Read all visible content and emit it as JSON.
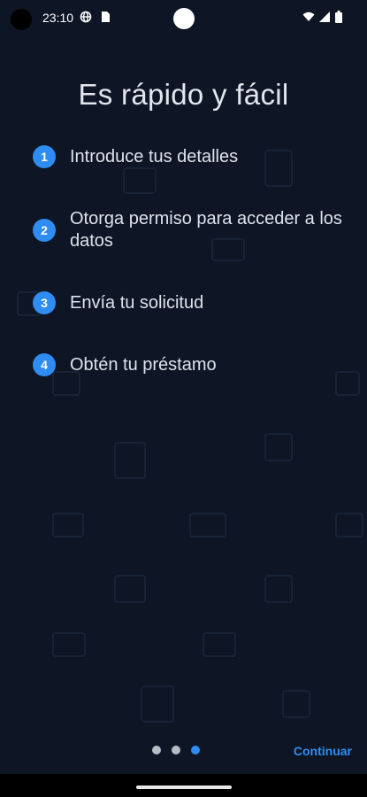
{
  "status_bar": {
    "time": "23:10",
    "icons": [
      "vpn-globe-icon",
      "sim-card-icon",
      "wifi-icon",
      "signal-icon",
      "battery-icon"
    ]
  },
  "title": "Es rápido y fácil",
  "steps": [
    {
      "number": "1",
      "text": "Introduce tus detalles"
    },
    {
      "number": "2",
      "text": "Otorga permiso para acceder a los datos"
    },
    {
      "number": "3",
      "text": "Envía tu solicitud"
    },
    {
      "number": "4",
      "text": "Obtén tu préstamo"
    }
  ],
  "pager": {
    "total": 3,
    "active_index": 2
  },
  "continue_label": "Continuar",
  "colors": {
    "background": "#0e1626",
    "accent": "#2f8cf2",
    "text": "#dde2ea",
    "dot_inactive": "#b8bcc4"
  }
}
